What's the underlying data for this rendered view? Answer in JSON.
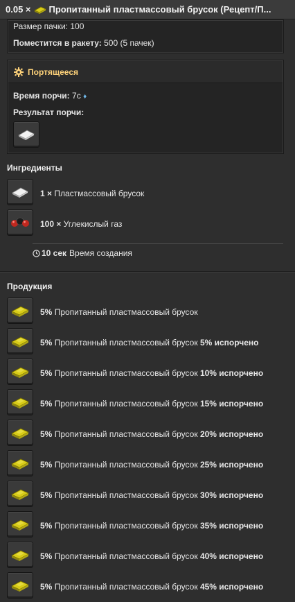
{
  "title": {
    "amount": "0.05 ×",
    "text": "Пропитанный пластмассовый брусок (Рецепт/П..."
  },
  "stack": {
    "size_label": "Размер пачки:",
    "size_value": "100",
    "rocket_label": "Поместится в ракету:",
    "rocket_value": "500 (5 пачек)"
  },
  "spoil": {
    "header": "Портящееся",
    "time_label": "Время порчи:",
    "time_value": "7с",
    "time_marker": "♦",
    "result_label": "Результат порчи:"
  },
  "ingredients": {
    "title": "Ингредиенты",
    "items": [
      {
        "amount": "1 ×",
        "name": "Пластмассовый брусок",
        "icon": "plastic-bar-icon"
      },
      {
        "amount": "100 ×",
        "name": "Углекислый газ",
        "icon": "carbon-dioxide-icon"
      }
    ],
    "time_value": "10 сек",
    "time_label": "Время создания"
  },
  "products": {
    "title": "Продукция",
    "items": [
      {
        "chance": "5%",
        "name": "Пропитанный пластмассовый брусок",
        "spoiled": ""
      },
      {
        "chance": "5%",
        "name": "Пропитанный пластмассовый брусок",
        "spoiled": "5% испорчено"
      },
      {
        "chance": "5%",
        "name": "Пропитанный пластмассовый брусок",
        "spoiled": "10% испорчено"
      },
      {
        "chance": "5%",
        "name": "Пропитанный пластмассовый брусок",
        "spoiled": "15% испорчено"
      },
      {
        "chance": "5%",
        "name": "Пропитанный пластмассовый брусок",
        "spoiled": "20% испорчено"
      },
      {
        "chance": "5%",
        "name": "Пропитанный пластмассовый брусок",
        "spoiled": "25% испорчено"
      },
      {
        "chance": "5%",
        "name": "Пропитанный пластмассовый брусок",
        "spoiled": "30% испорчено"
      },
      {
        "chance": "5%",
        "name": "Пропитанный пластмассовый брусок",
        "spoiled": "35% испорчено"
      },
      {
        "chance": "5%",
        "name": "Пропитанный пластмассовый брусок",
        "spoiled": "40% испорчено"
      },
      {
        "chance": "5%",
        "name": "Пропитанный пластмассовый брусок",
        "spoiled": "45% испорчено"
      }
    ]
  },
  "colors": {
    "accent_heading": "#ffd37a",
    "background": "#2e2e2e",
    "panel": "#242424",
    "item_yellow": "#d8cc18"
  }
}
